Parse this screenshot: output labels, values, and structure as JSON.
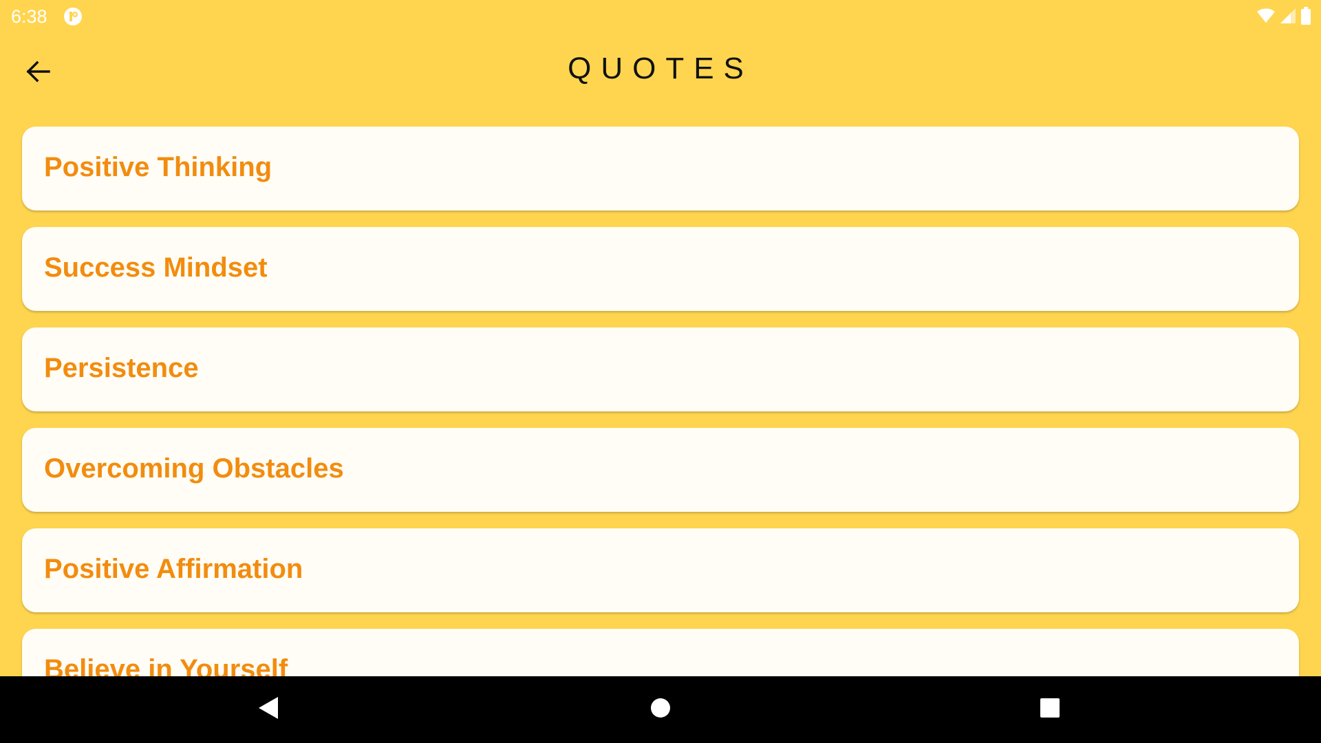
{
  "colors": {
    "background": "#FFD54F",
    "card": "#FFFDF5",
    "card_text": "#F28C0F",
    "title": "#111111",
    "nav_bar": "#000000"
  },
  "status_bar": {
    "time": "6:38",
    "app_icon": "notification-app-icon",
    "wifi_icon": "wifi-icon",
    "signal_icon": "cell-signal-icon",
    "battery_icon": "battery-icon"
  },
  "app_bar": {
    "back_icon": "arrow-back-icon",
    "title": "QUOTES"
  },
  "categories": [
    {
      "label": "Positive Thinking"
    },
    {
      "label": "Success Mindset"
    },
    {
      "label": "Persistence"
    },
    {
      "label": "Overcoming Obstacles"
    },
    {
      "label": "Positive Affirmation"
    },
    {
      "label": "Believe in Yourself"
    }
  ],
  "nav_bar": {
    "back_icon": "nav-back-triangle-icon",
    "home_icon": "nav-home-circle-icon",
    "recents_icon": "nav-recents-square-icon"
  }
}
